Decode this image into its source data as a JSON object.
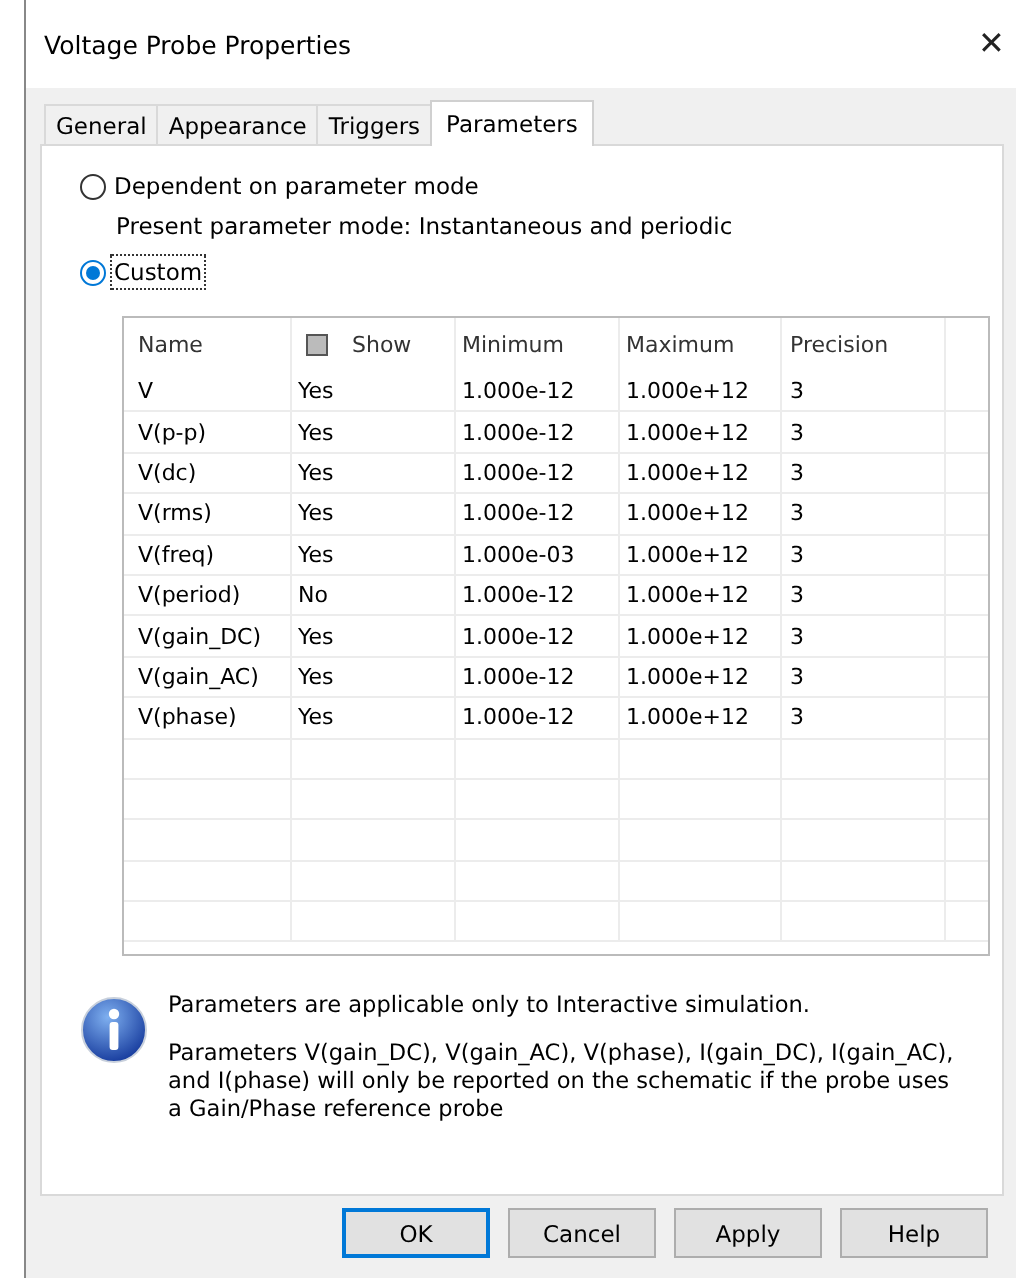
{
  "window": {
    "title": "Voltage Probe Properties",
    "close": "✕"
  },
  "tabs": [
    {
      "label": "General",
      "selected": false
    },
    {
      "label": "Appearance",
      "selected": false
    },
    {
      "label": "Triggers",
      "selected": false
    },
    {
      "label": "Parameters",
      "selected": true
    }
  ],
  "mode_options": [
    {
      "label": "Dependent on parameter mode",
      "selected": false,
      "note": "Present parameter mode:  Instantaneous and periodic"
    },
    {
      "label": "Custom",
      "selected": true,
      "focused": true
    }
  ],
  "table": {
    "columns": [
      {
        "label": "Name"
      },
      {
        "label": "Show",
        "header_checkbox_mixed": true
      },
      {
        "label": "Minimum"
      },
      {
        "label": "Maximum"
      },
      {
        "label": "Precision"
      }
    ],
    "rows": [
      [
        "V",
        "Yes",
        "1.000e-12",
        "1.000e+12",
        "3"
      ],
      [
        "V(p-p)",
        "Yes",
        "1.000e-12",
        "1.000e+12",
        "3"
      ],
      [
        "V(dc)",
        "Yes",
        "1.000e-12",
        "1.000e+12",
        "3"
      ],
      [
        "V(rms)",
        "Yes",
        "1.000e-12",
        "1.000e+12",
        "3"
      ],
      [
        "V(freq)",
        "Yes",
        "1.000e-03",
        "1.000e+12",
        "3"
      ],
      [
        "V(period)",
        "No",
        "1.000e-12",
        "1.000e+12",
        "3"
      ],
      [
        "V(gain_DC)",
        "Yes",
        "1.000e-12",
        "1.000e+12",
        "3"
      ],
      [
        "V(gain_AC)",
        "Yes",
        "1.000e-12",
        "1.000e+12",
        "3"
      ],
      [
        "V(phase)",
        "Yes",
        "1.000e-12",
        "1.000e+12",
        "3"
      ]
    ]
  },
  "info": [
    "Parameters are applicable only to Interactive simulation.",
    "Parameters V(gain_DC), V(gain_AC), V(phase), I(gain_DC), I(gain_AC), and I(phase) will only be reported on the schematic if the probe uses a Gain/Phase reference probe"
  ],
  "buttons": [
    {
      "label": "OK",
      "default": true
    },
    {
      "label": "Cancel",
      "default": false
    },
    {
      "label": "Apply",
      "default": false
    },
    {
      "label": "Help",
      "default": false
    }
  ]
}
